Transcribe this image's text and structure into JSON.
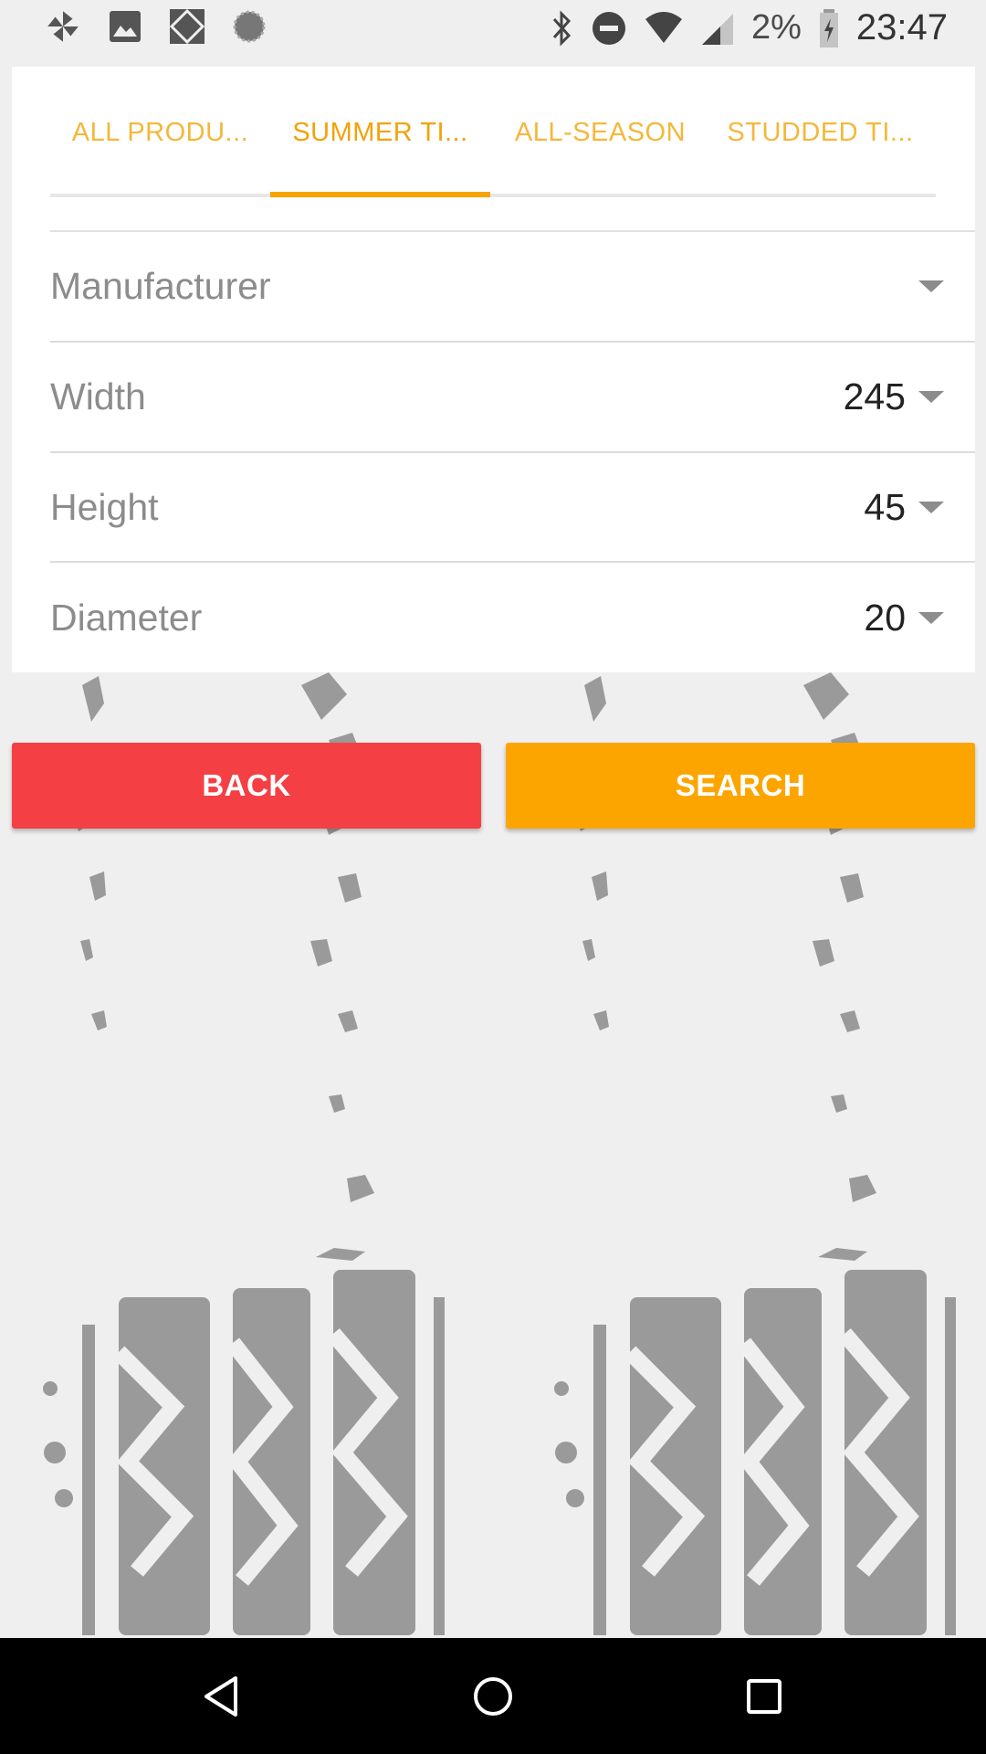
{
  "status_bar": {
    "battery_percent": "2%",
    "time": "23:47",
    "left_icons": [
      "pinwheel-icon",
      "image-icon",
      "diamond-grid-icon",
      "circle-dots-icon"
    ],
    "right_icons": [
      "bluetooth-icon",
      "do-not-disturb-icon",
      "wifi-icon",
      "signal-icon",
      "battery-charging-icon"
    ]
  },
  "tabs": [
    {
      "label": "ALL PRODU...",
      "active": false
    },
    {
      "label": "SUMMER TI...",
      "active": true
    },
    {
      "label": "ALL-SEASON",
      "active": false
    },
    {
      "label": "STUDDED TI...",
      "active": false
    }
  ],
  "filters": {
    "manufacturer": {
      "label": "Manufacturer",
      "value": ""
    },
    "width": {
      "label": "Width",
      "value": "245"
    },
    "height": {
      "label": "Height",
      "value": "45"
    },
    "diameter": {
      "label": "Diameter",
      "value": "20"
    }
  },
  "actions": {
    "back_label": "BACK",
    "search_label": "SEARCH"
  },
  "colors": {
    "accent": "#f5a400",
    "back_button": "#f43f44",
    "search_button": "#fca500",
    "tab_text": "#f5b73a"
  },
  "nav_bar": {
    "buttons": [
      "back-triangle-icon",
      "home-circle-icon",
      "recents-square-icon"
    ]
  }
}
